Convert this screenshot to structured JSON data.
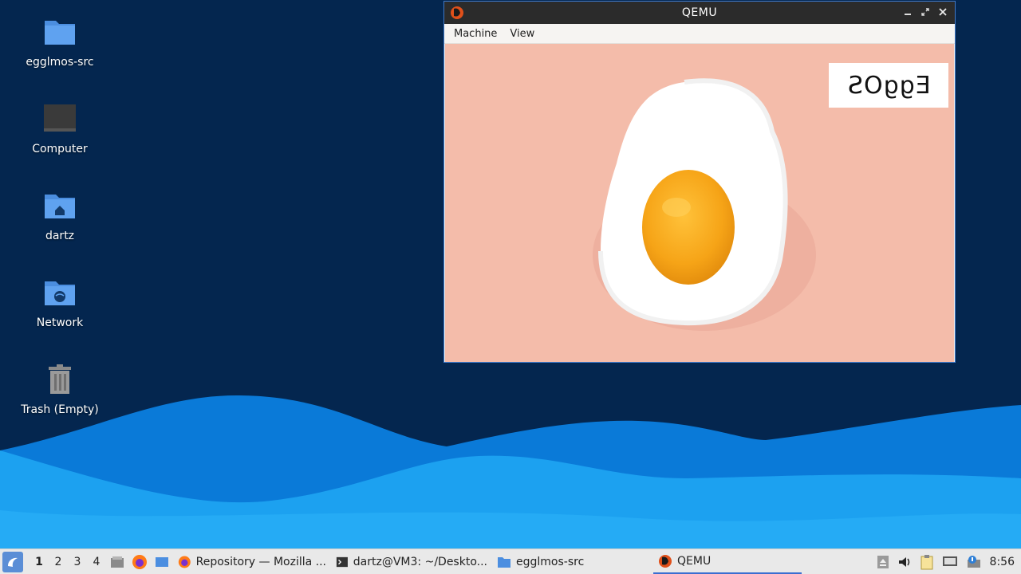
{
  "desktop": {
    "icons": [
      {
        "label": "egglmos-src",
        "icon": "folder-icon"
      },
      {
        "label": "Computer",
        "icon": "computer-icon"
      },
      {
        "label": "dartz",
        "icon": "home-folder-icon"
      },
      {
        "label": "Network",
        "icon": "network-folder-icon"
      },
      {
        "label": "Trash (Empty)",
        "icon": "trash-icon"
      }
    ],
    "colors": {
      "background": "#04264f",
      "wave_dark": "#0878d6",
      "wave_light": "#1ba6f5"
    }
  },
  "qemu_window": {
    "title": "QEMU",
    "menu": [
      "Machine",
      "View"
    ],
    "screen": {
      "logo_text": "EggOS"
    }
  },
  "taskbar": {
    "workspaces": [
      "1",
      "2",
      "3",
      "4"
    ],
    "active_workspace": "1",
    "tasks": [
      {
        "label": "Repository — Mozilla ...",
        "icon": "firefox-icon"
      },
      {
        "label": "dartz@VM3: ~/Deskto...",
        "icon": "terminal-icon"
      },
      {
        "label": "egglmos-src",
        "icon": "folder-icon"
      },
      {
        "label": "QEMU",
        "icon": "qemu-icon",
        "active": true
      }
    ],
    "clock": "8:56"
  }
}
